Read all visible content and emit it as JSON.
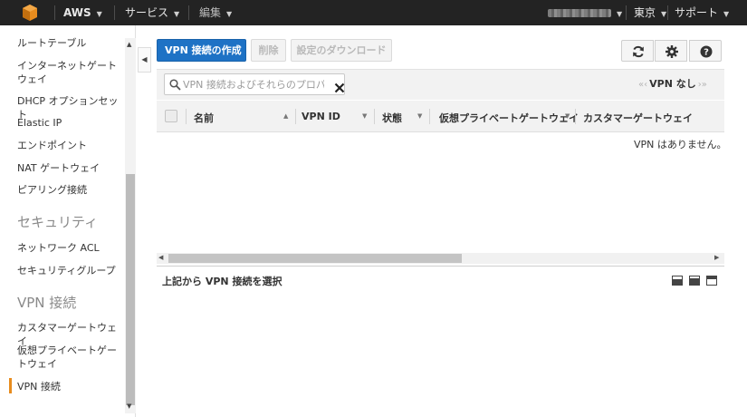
{
  "topnav": {
    "brand": "AWS",
    "services": "サービス",
    "edit": "編集",
    "region": "東京",
    "support": "サポート",
    "colors": {
      "bar": "#232323",
      "logo": "#e88c1e"
    }
  },
  "sidebar": {
    "items_top": [
      {
        "label": "ルートテーブル"
      },
      {
        "label": "インターネットゲートウェイ"
      },
      {
        "label": "DHCP オプションセット"
      },
      {
        "label": "Elastic IP"
      },
      {
        "label": "エンドポイント"
      },
      {
        "label": "NAT ゲートウェイ"
      },
      {
        "label": "ピアリング接続"
      }
    ],
    "security_header": "セキュリティ",
    "security_items": [
      {
        "label": "ネットワーク ACL"
      },
      {
        "label": "セキュリティグループ"
      }
    ],
    "vpn_header": "VPN 接続",
    "vpn_items": [
      {
        "label": "カスタマーゲートウェイ"
      },
      {
        "label": "仮想プライベートゲートウェイ"
      },
      {
        "label": "VPN 接続",
        "active": true
      }
    ],
    "active_color": "#e88c1e"
  },
  "toolbar": {
    "create_label": "VPN 接続の作成",
    "delete_label": "削除",
    "download_label": "設定のダウンロード",
    "refresh_icon": "refresh-icon",
    "settings_icon": "gear-icon",
    "help_icon": "help-icon",
    "primary_color": "#1e72c5"
  },
  "filter": {
    "placeholder": "VPN 接続およびそれらのプロパティでフィルタリング",
    "pager_label": "VPN なし"
  },
  "table": {
    "columns": [
      "名前",
      "VPN ID",
      "状態",
      "仮想プライベートゲートウェイ",
      "カスタマーゲートウェイ"
    ],
    "empty_message": "VPN はありません。"
  },
  "details": {
    "title": "上記から VPN 接続を選択"
  }
}
